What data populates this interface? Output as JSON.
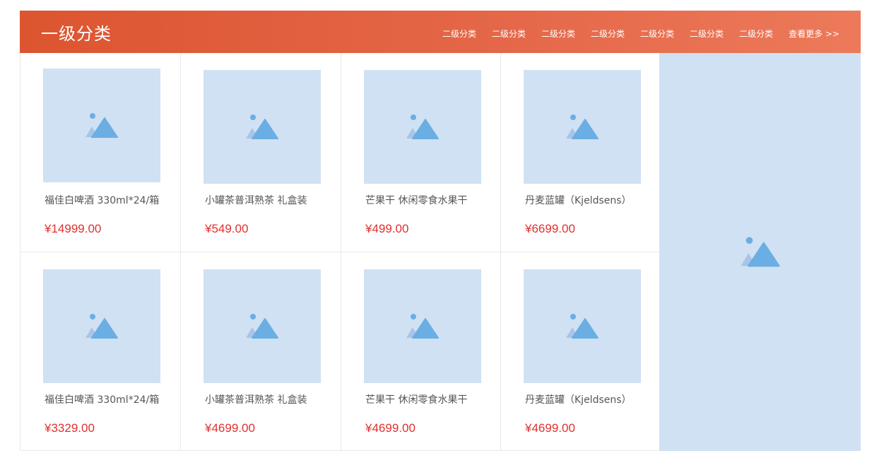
{
  "header": {
    "title": "一级分类",
    "subcategories": [
      "二级分类",
      "二级分类",
      "二级分类",
      "二级分类",
      "二级分类",
      "二级分类",
      "二级分类"
    ],
    "more_label": "查看更多 >>"
  },
  "products": [
    {
      "name": "福佳白啤酒 330ml*24/箱",
      "price": "¥14999.00"
    },
    {
      "name": "小罐茶普洱熟茶 礼盒装",
      "price": "¥549.00"
    },
    {
      "name": "芒果干 休闲零食水果干",
      "price": "¥499.00"
    },
    {
      "name": "丹麦蓝罐（Kjeldsens）",
      "price": "¥6699.00"
    },
    {
      "name": "福佳白啤酒 330ml*24/箱",
      "price": "¥3329.00"
    },
    {
      "name": "小罐茶普洱熟茶 礼盒装",
      "price": "¥4699.00"
    },
    {
      "name": "芒果干 休闲零食水果干",
      "price": "¥4699.00"
    },
    {
      "name": "丹麦蓝罐（Kjeldsens）",
      "price": "¥4699.00"
    }
  ],
  "icons": {
    "placeholder": "image-placeholder-icon"
  },
  "colors": {
    "header_start": "#dc5530",
    "header_end": "#ec7a5a",
    "placeholder_bg": "#d0e1f3",
    "price": "#e0302f"
  }
}
